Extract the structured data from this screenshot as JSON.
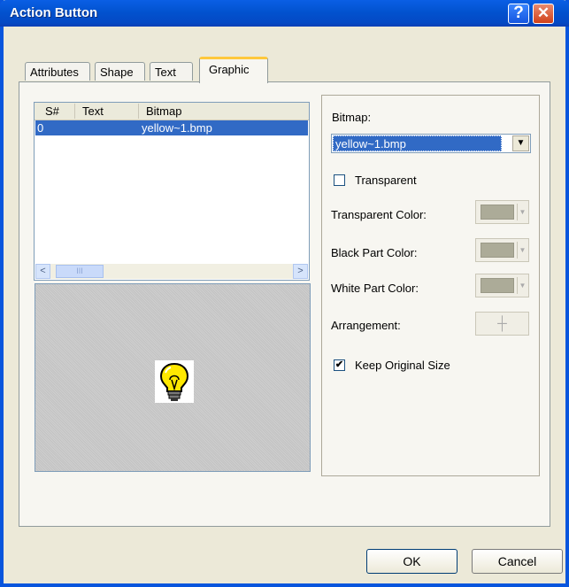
{
  "window": {
    "title": "Action Button"
  },
  "titlebar": {
    "help_glyph": "?",
    "close_glyph": "✕"
  },
  "tabs": [
    {
      "label": "Attributes"
    },
    {
      "label": "Shape"
    },
    {
      "label": "Text"
    },
    {
      "label": "Graphic",
      "active": true
    }
  ],
  "list": {
    "columns": [
      "S#",
      "Text",
      "Bitmap"
    ],
    "rows": [
      {
        "s": "0",
        "text": "",
        "bitmap": "yellow~1.bmp",
        "selected": true
      }
    ]
  },
  "scrollbar": {
    "left": "<",
    "right": ">",
    "thumb_grip": "III"
  },
  "preview": {
    "icon": "lightbulb-icon"
  },
  "right": {
    "bitmap_label": "Bitmap:",
    "bitmap_value": "yellow~1.bmp",
    "transparent_label": "Transparent",
    "transparent_checked": false,
    "transparent_color_label": "Transparent Color:",
    "black_part_label": "Black Part Color:",
    "white_part_label": "White Part Color:",
    "arrangement_label": "Arrangement:",
    "keep_original_label": "Keep Original Size",
    "keep_original_checked": true,
    "checkmark": "✔"
  },
  "buttons": {
    "ok": "OK",
    "cancel": "Cancel"
  },
  "colors": {
    "title_bar": "#0855dd",
    "selection": "#316ac5",
    "swatch": "#acab98"
  }
}
